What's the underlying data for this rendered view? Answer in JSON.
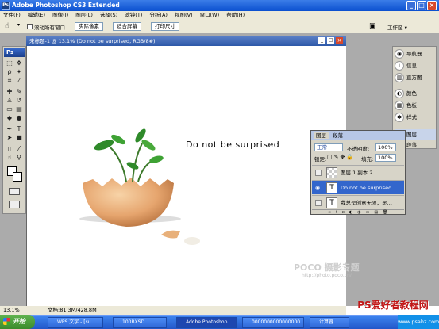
{
  "app": {
    "title": "Adobe Photoshop CS3 Extended",
    "logo": "Ps"
  },
  "menu": [
    "文件(F)",
    "编辑(E)",
    "图像(I)",
    "图层(L)",
    "选择(S)",
    "滤镜(T)",
    "分析(A)",
    "视图(V)",
    "窗口(W)",
    "帮助(H)"
  ],
  "options": {
    "checkbox_label": "滚动所有窗口",
    "buttons": [
      "实际像素",
      "适合屏幕",
      "打印尺寸"
    ],
    "workspace": "工作区 ▾"
  },
  "document": {
    "title": "未标题-1 @ 13.1% (Do not be surprised, RGB/8#)",
    "headline": "Do not be surprised",
    "watermark_brand": "POCO 摄影专题",
    "watermark_url": "http://photo.poco.cn/"
  },
  "dock": [
    "导航器",
    "信息",
    "直方图",
    "颜色",
    "色板",
    "样式",
    "图层",
    "段落"
  ],
  "layers_panel": {
    "tabs": [
      "图层",
      "段落"
    ],
    "blend_mode": "正常",
    "opacity_label": "不透明度:",
    "opacity_value": "100%",
    "lock_label": "锁定:",
    "fill_label": "填充:",
    "fill_value": "100%",
    "rows": [
      {
        "name": "图层 1 副本 2",
        "thumb": "",
        "visible": false,
        "selected": false
      },
      {
        "name": "Do not be surprised",
        "thumb": "T",
        "visible": true,
        "selected": true
      },
      {
        "name": "我总是创意无限，灵…",
        "thumb": "T",
        "visible": false,
        "selected": false
      }
    ]
  },
  "status": {
    "zoom": "13.1%",
    "doc": "文档:81.3M/428.8M"
  },
  "taskbar": {
    "start": "开始",
    "items": [
      "WPS 文字 - [su...",
      "100BXSD",
      "Adobe Photoshop ...",
      "0000000000000000...",
      "计算器"
    ],
    "tray_time": "WWW.psahz.com"
  },
  "site_watermark": {
    "line1": "PS爱好者教程网",
    "line2": "www.psahz.com"
  },
  "colors": {
    "title_blue": "#0a4fcf",
    "selected_layer": "#3366cc",
    "start_green": "#3b8b2c"
  }
}
